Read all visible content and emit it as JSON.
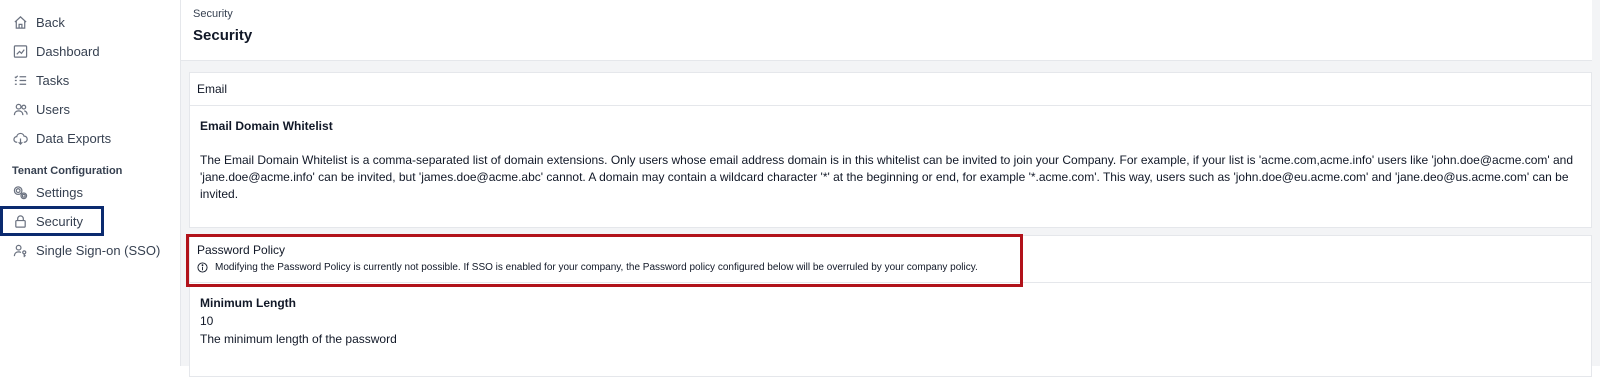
{
  "sidebar": {
    "items": [
      {
        "label": "Back",
        "icon": "home-icon"
      },
      {
        "label": "Dashboard",
        "icon": "chart-icon"
      },
      {
        "label": "Tasks",
        "icon": "list-icon"
      },
      {
        "label": "Users",
        "icon": "users-icon"
      },
      {
        "label": "Data Exports",
        "icon": "cloud-download-icon"
      }
    ],
    "section_label": "Tenant Configuration",
    "config_items": [
      {
        "label": "Settings",
        "icon": "gear-icon"
      },
      {
        "label": "Security",
        "icon": "lock-icon",
        "selected": true
      },
      {
        "label": "Single Sign-on (SSO)",
        "icon": "user-key-icon"
      }
    ]
  },
  "header": {
    "breadcrumb": "Security",
    "title": "Security"
  },
  "email_card": {
    "title": "Email",
    "field_title": "Email Domain Whitelist",
    "description": "The Email Domain Whitelist is a comma-separated list of domain extensions. Only users whose email address domain is in this whitelist can be invited to join your Company. For example, if your list is 'acme.com,acme.info' users like 'john.doe@acme.com' and 'jane.doe@acme.info' can be invited, but 'james.doe@acme.abc' cannot. A domain may contain a wildcard character '*' at the beginning or end, for example '*.acme.com'. This way, users such as 'john.doe@eu.acme.com' and 'jane.deo@us.acme.com' can be invited."
  },
  "password_card": {
    "title": "Password Policy",
    "note": "Modifying the Password Policy is currently not possible. If SSO is enabled for your company, the Password policy configured below will be overruled by your company policy.",
    "min_length_title": "Minimum Length",
    "min_length_value": "10",
    "min_length_desc": "The minimum length of the password"
  },
  "colors": {
    "security_highlight": "#0b2a6f",
    "password_highlight": "#b1121a",
    "background": "#f3f4f6"
  }
}
